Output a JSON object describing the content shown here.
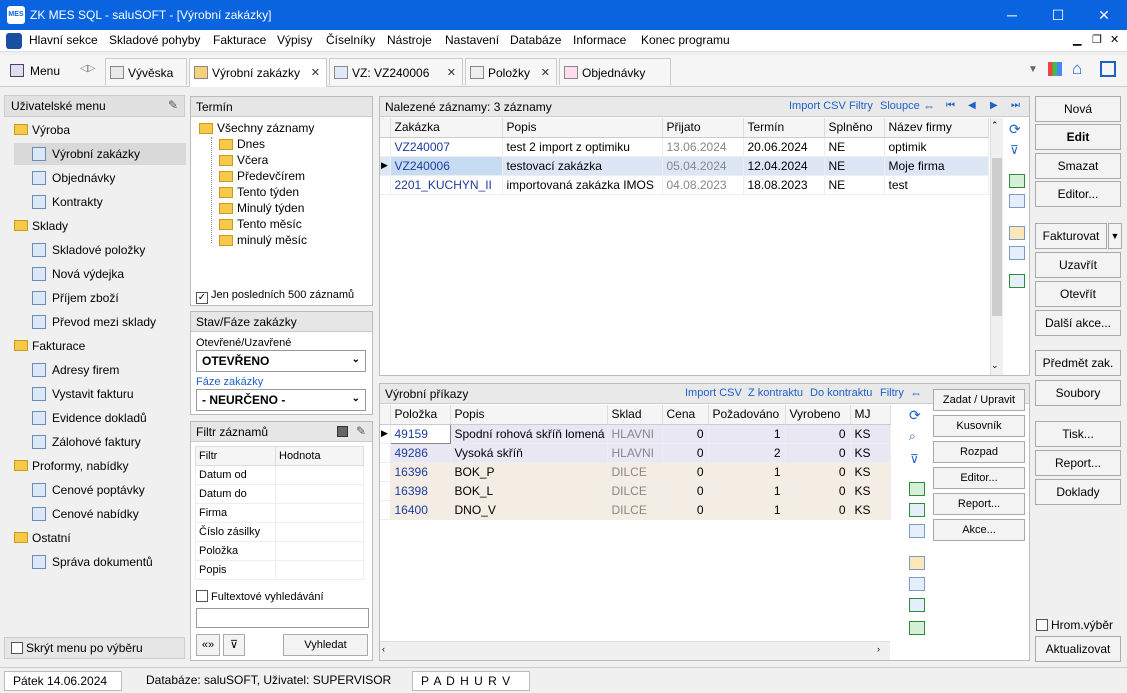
{
  "window": {
    "title": "ZK MES SQL - saluSOFT - [Výrobní zakázky]",
    "logo": "MES",
    "min": "─",
    "max": "☐",
    "close": "✕"
  },
  "menu": [
    "Hlavní sekce",
    "Skladové pohyby",
    "Fakturace",
    "Výpisy",
    "Číselníky",
    "Nástroje",
    "Nastavení",
    "Databáze",
    "Informace",
    "Konec programu"
  ],
  "tabs": {
    "menu_label": "Menu",
    "items": [
      "Vývěska",
      "Výrobní zakázky",
      "VZ: VZ240006",
      "Položky",
      "Objednávky"
    ]
  },
  "sidebar": {
    "title": "Uživatelské menu",
    "sections": [
      {
        "label": "Výroba",
        "items": [
          "Výrobní zakázky",
          "Objednávky",
          "Kontrakty"
        ]
      },
      {
        "label": "Sklady",
        "items": [
          "Skladové položky",
          "Nová výdejka",
          "Příjem zboží",
          "Převod mezi sklady"
        ]
      },
      {
        "label": "Fakturace",
        "items": [
          "Adresy firem",
          "Vystavit fakturu",
          "Evidence dokladů",
          "Zálohové faktury"
        ]
      },
      {
        "label": "Proformy, nabídky",
        "items": [
          "Cenové poptávky",
          "Cenové nabídky"
        ]
      },
      {
        "label": "Ostatní",
        "items": [
          "Správa dokumentů"
        ]
      }
    ],
    "hide_label": "Skrýt menu po výběru"
  },
  "termin": {
    "title": "Termín",
    "root": "Všechny záznamy",
    "items": [
      "Dnes",
      "Včera",
      "Předevčírem",
      "Tento týden",
      "Minulý týden",
      "Tento měsíc",
      "minulý měsíc"
    ],
    "last500": "Jen posledních 500 záznamů"
  },
  "stav": {
    "title": "Stav/Fáze zakázky",
    "open_label": "Otevřené/Uzavřené",
    "open_value": "OTEVŘENO",
    "phase_label": "Fáze zakázky",
    "phase_value": "- NEURČENO -"
  },
  "filtr": {
    "title": "Filtr záznamů",
    "col_filtr": "Filtr",
    "col_hodnota": "Hodnota",
    "rows": [
      "Datum od",
      "Datum do",
      "Firma",
      "Číslo zásilky",
      "Položka",
      "Popis"
    ],
    "fulltext": "Fultextové vyhledávání",
    "expand": "«»",
    "search_btn": "Vyhledat"
  },
  "records": {
    "heading": "Nalezené záznamy: 3 záznamy",
    "links": [
      "Import CSV",
      "Filtry",
      "Sloupce"
    ],
    "columns": [
      "Zakázka",
      "Popis",
      "Přijato",
      "Termín",
      "Splněno",
      "Název firmy"
    ],
    "rows": [
      [
        "VZ240007",
        "test 2 import z optimiku",
        "13.06.2024",
        "20.06.2024",
        "NE",
        "optimik"
      ],
      [
        "VZ240006",
        "testovací zakázka",
        "05.04.2024",
        "12.04.2024",
        "NE",
        "Moje firma"
      ],
      [
        "2201_KUCHYN_II",
        "importovaná zakázka IMOS",
        "04.08.2023",
        "18.08.2023",
        "NE",
        "test"
      ]
    ]
  },
  "prikazy": {
    "heading": "Výrobní příkazy",
    "links": [
      "Import CSV",
      "Z kontraktu",
      "Do kontraktu",
      "Filtry"
    ],
    "columns": [
      "Položka",
      "Popis",
      "Sklad",
      "Cena",
      "Požadováno",
      "Vyrobeno",
      "MJ"
    ],
    "rows": [
      [
        "49159",
        "Spodní rohová skříň lomená",
        "HLAVNI",
        "0",
        "1",
        "0",
        "KS"
      ],
      [
        "49286",
        "Vysoká skříň",
        "HLAVNI",
        "0",
        "2",
        "0",
        "KS"
      ],
      [
        "16396",
        "BOK_P",
        "DILCE",
        "0",
        "1",
        "0",
        "KS"
      ],
      [
        "16398",
        "BOK_L",
        "DILCE",
        "0",
        "1",
        "0",
        "KS"
      ],
      [
        "16400",
        "DNO_V",
        "DILCE",
        "0",
        "1",
        "0",
        "KS"
      ]
    ],
    "buttons": [
      "Zadat / Upravit",
      "Kusovník",
      "Rozpad",
      "Editor...",
      "Report...",
      "Akce..."
    ]
  },
  "actions": {
    "buttons": [
      "Nová",
      "Edit",
      "Smazat",
      "Editor...",
      "Fakturovat",
      "Uzavřít",
      "Otevřít",
      "Další akce...",
      "Předmět zak.",
      "Soubory",
      "Tisk...",
      "Report...",
      "Doklady"
    ],
    "hrom": "Hrom.výběr",
    "refresh": "Aktualizovat"
  },
  "status": {
    "date": "Pátek 14.06.2024",
    "db": "Databáze: saluSOFT, Uživatel: SUPERVISOR",
    "flags": "P A D H U R V"
  }
}
